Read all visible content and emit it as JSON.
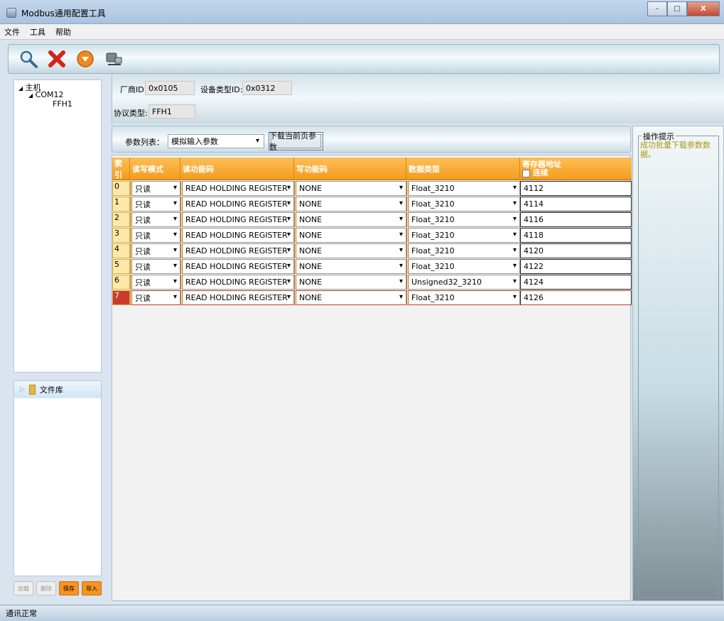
{
  "window": {
    "title": "Modbus通用配置工具",
    "minimize": "–",
    "maximize": "□",
    "close": "X"
  },
  "menu": [
    "文件",
    "工具",
    "帮助"
  ],
  "toolbar": {
    "icons": [
      "search-icon",
      "delete-icon",
      "download-icon",
      "connect-icon"
    ]
  },
  "tree": {
    "root": "主机",
    "port": "COM12",
    "device": "FFH1"
  },
  "file_library": {
    "label": "文件库"
  },
  "left_buttons": {
    "add": "加载",
    "delete": "删除",
    "save": "保存",
    "import": "导入"
  },
  "device_info": {
    "vendor_label": "厂商ID:",
    "vendor_value": "0x0105",
    "type_label": "设备类型ID:",
    "type_value": "0x0312",
    "protocol_label": "协议类型:",
    "protocol_value": "FFH1"
  },
  "param_bar": {
    "label": "参数列表：",
    "selected": "模拟输入参数",
    "download_button": "下载当前页参数"
  },
  "grid": {
    "headers": {
      "index": "索引",
      "rw_mode": "读写模式",
      "read_func": "读功能码",
      "write_func": "写功能码",
      "data_type": "数据类型",
      "address": "寄存器地址",
      "continuous": "连续"
    },
    "rows": [
      {
        "index": "0",
        "rw": "只读",
        "read": "READ HOLDING REGISTER",
        "write": "NONE",
        "type": "Float_3210",
        "addr": "4112"
      },
      {
        "index": "1",
        "rw": "只读",
        "read": "READ HOLDING REGISTER",
        "write": "NONE",
        "type": "Float_3210",
        "addr": "4114"
      },
      {
        "index": "2",
        "rw": "只读",
        "read": "READ HOLDING REGISTER",
        "write": "NONE",
        "type": "Float_3210",
        "addr": "4116"
      },
      {
        "index": "3",
        "rw": "只读",
        "read": "READ HOLDING REGISTER",
        "write": "NONE",
        "type": "Float_3210",
        "addr": "4118"
      },
      {
        "index": "4",
        "rw": "只读",
        "read": "READ HOLDING REGISTER",
        "write": "NONE",
        "type": "Float_3210",
        "addr": "4120"
      },
      {
        "index": "5",
        "rw": "只读",
        "read": "READ HOLDING REGISTER",
        "write": "NONE",
        "type": "Float_3210",
        "addr": "4122"
      },
      {
        "index": "6",
        "rw": "只读",
        "read": "READ HOLDING REGISTER",
        "write": "NONE",
        "type": "Unsigned32_3210",
        "addr": "4124"
      },
      {
        "index": "7",
        "rw": "只读",
        "read": "READ HOLDING REGISTER",
        "write": "NONE",
        "type": "Float_3210",
        "addr": "4126"
      }
    ]
  },
  "tips": {
    "title": "操作提示",
    "message": "成功批量下载参数数据。"
  },
  "status": {
    "text": "通讯正常"
  },
  "colors": {
    "header_orange": "#f39c1c",
    "selected_row": "#c93b2c",
    "tip_text": "#a99a16"
  }
}
